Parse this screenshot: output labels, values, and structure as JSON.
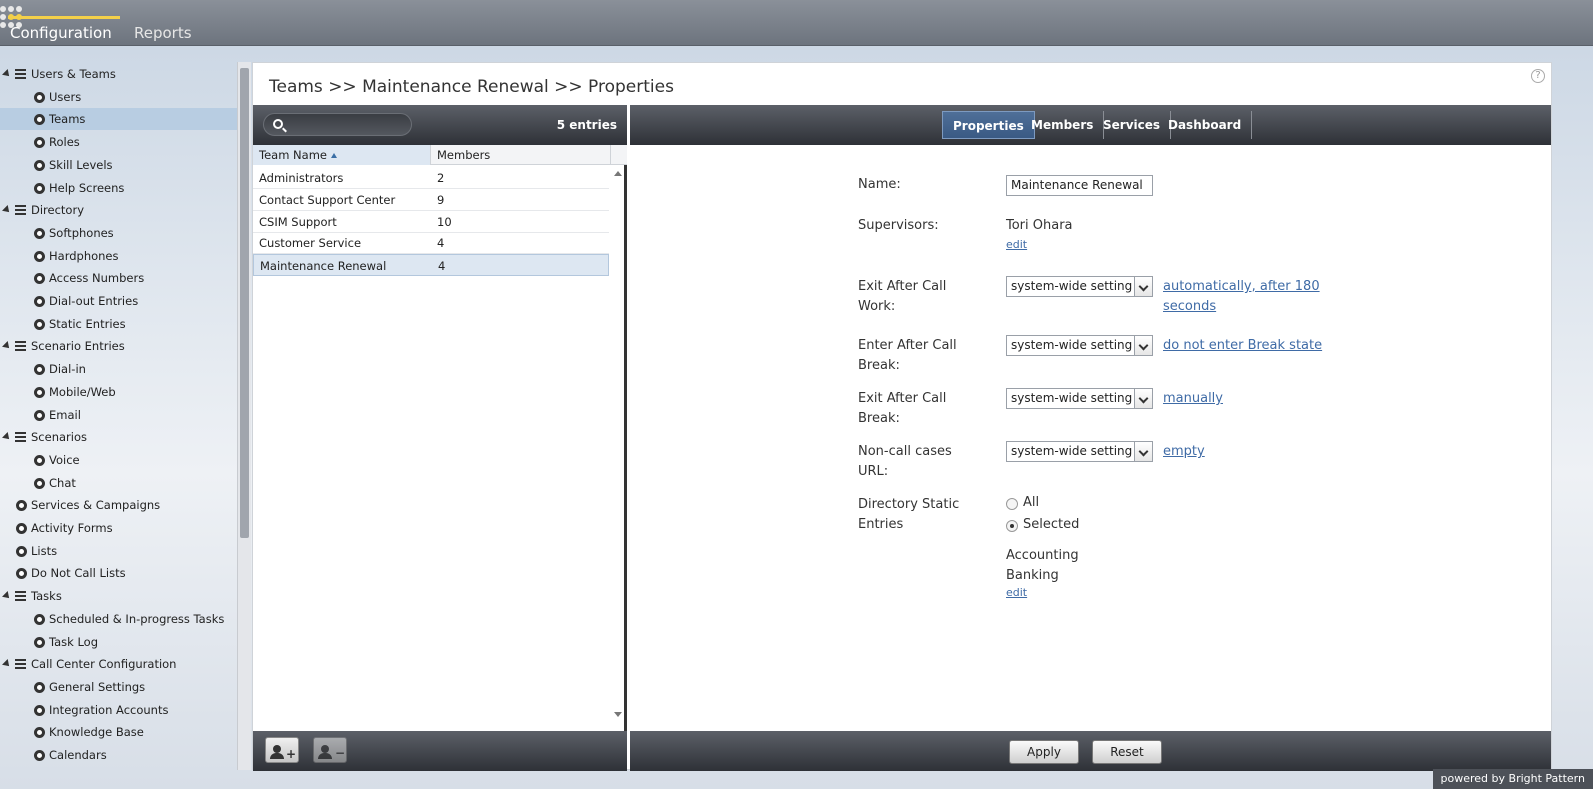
{
  "topnav": {
    "tabs": [
      {
        "label": "Configuration"
      },
      {
        "label": "Reports"
      }
    ]
  },
  "sidebar": {
    "items": [
      {
        "label": "Users & Teams",
        "type": "group"
      },
      {
        "label": "Users",
        "type": "child"
      },
      {
        "label": "Teams",
        "type": "child",
        "selected": true
      },
      {
        "label": "Roles",
        "type": "child"
      },
      {
        "label": "Skill Levels",
        "type": "child"
      },
      {
        "label": "Help Screens",
        "type": "child"
      },
      {
        "label": "Directory",
        "type": "group"
      },
      {
        "label": "Softphones",
        "type": "child"
      },
      {
        "label": "Hardphones",
        "type": "child"
      },
      {
        "label": "Access Numbers",
        "type": "child"
      },
      {
        "label": "Dial-out Entries",
        "type": "child"
      },
      {
        "label": "Static Entries",
        "type": "child"
      },
      {
        "label": "Scenario Entries",
        "type": "group"
      },
      {
        "label": "Dial-in",
        "type": "child"
      },
      {
        "label": "Mobile/Web",
        "type": "child"
      },
      {
        "label": "Email",
        "type": "child"
      },
      {
        "label": "Scenarios",
        "type": "group"
      },
      {
        "label": "Voice",
        "type": "child"
      },
      {
        "label": "Chat",
        "type": "child"
      },
      {
        "label": "Services & Campaigns",
        "type": "top"
      },
      {
        "label": "Activity Forms",
        "type": "top"
      },
      {
        "label": "Lists",
        "type": "top"
      },
      {
        "label": "Do Not Call Lists",
        "type": "top"
      },
      {
        "label": "Tasks",
        "type": "group"
      },
      {
        "label": "Scheduled & In-progress Tasks",
        "type": "child"
      },
      {
        "label": "Task Log",
        "type": "child"
      },
      {
        "label": "Call Center Configuration",
        "type": "group"
      },
      {
        "label": "General Settings",
        "type": "child"
      },
      {
        "label": "Integration Accounts",
        "type": "child"
      },
      {
        "label": "Knowledge Base",
        "type": "child"
      },
      {
        "label": "Calendars",
        "type": "child"
      }
    ]
  },
  "main": {
    "breadcrumb": "Teams >> Maintenance Renewal >> Properties",
    "help": "?"
  },
  "list": {
    "entries": "5 entries",
    "search": {
      "value": "",
      "placeholder": ""
    },
    "columns": [
      "Team Name",
      "Members"
    ],
    "rows": [
      {
        "name": "Administrators",
        "members": "2"
      },
      {
        "name": "Contact Support Center",
        "members": "9"
      },
      {
        "name": "CSIM Support",
        "members": "10"
      },
      {
        "name": "Customer Service",
        "members": "4"
      },
      {
        "name": "Maintenance Renewal",
        "members": "4"
      }
    ]
  },
  "detail": {
    "tabs": [
      "Properties",
      "Members",
      "Services",
      "Dashboard"
    ],
    "name_label": "Name:",
    "name_value": "Maintenance Renewal",
    "supervisors_label": "Supervisors:",
    "supervisors_value": "Tori Ohara",
    "edit": "edit",
    "fields": [
      {
        "label1": "Exit After Call",
        "label2": "Work:",
        "select": "system-wide setting",
        "link1": "automatically, after 180",
        "link2": "seconds"
      },
      {
        "label1": "Enter After Call",
        "label2": "Break:",
        "select": "system-wide setting",
        "link1": "do not enter Break state",
        "link2": ""
      },
      {
        "label1": "Exit After Call",
        "label2": "Break:",
        "select": "system-wide setting",
        "link1": "manually",
        "link2": ""
      },
      {
        "label1": "Non-call cases",
        "label2": "URL:",
        "select": "system-wide setting",
        "link1": "empty",
        "link2": ""
      }
    ],
    "dir_label1": "Directory Static",
    "dir_label2": "Entries",
    "radio_all": "All",
    "radio_selected": "Selected",
    "entries": [
      "Accounting",
      "Banking"
    ],
    "apply": "Apply",
    "reset": "Reset"
  },
  "footer": {
    "powered": "powered by Bright Pattern"
  }
}
